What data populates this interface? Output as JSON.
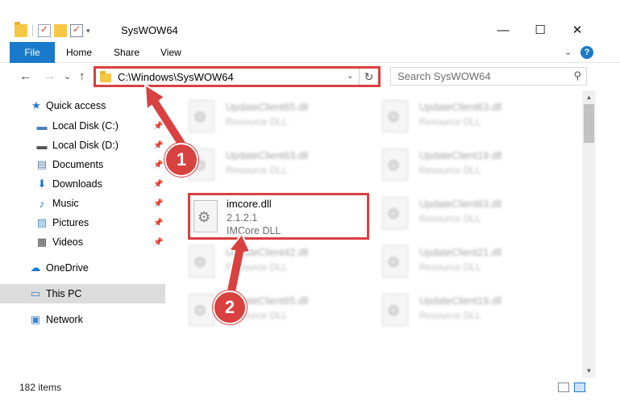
{
  "window": {
    "title": "SysWOW64",
    "controls": {
      "minimize": "—",
      "maximize": "☐",
      "close": "✕"
    }
  },
  "ribbon": {
    "tabs": {
      "file": "File",
      "home": "Home",
      "share": "Share",
      "view": "View"
    },
    "help": "?"
  },
  "addressbar": {
    "path": "C:\\Windows\\SysWOW64",
    "back": "←",
    "forward": "→",
    "recent": "⌄",
    "up": "↑",
    "refresh": "↻"
  },
  "search": {
    "placeholder": "Search SysWOW64"
  },
  "nav": {
    "quick_access": "Quick access",
    "local_c": "Local Disk (C:)",
    "local_d": "Local Disk (D:)",
    "documents": "Documents",
    "downloads": "Downloads",
    "music": "Music",
    "pictures": "Pictures",
    "videos": "Videos",
    "onedrive": "OneDrive",
    "this_pc": "This PC",
    "network": "Network"
  },
  "files": {
    "blurred": [
      {
        "name": "UpdateClient65.dll",
        "desc": "Resource DLL"
      },
      {
        "name": "UpdateClient63.dll",
        "desc": "Resource DLL"
      },
      {
        "name": "UpdateClient63.dll",
        "desc": "Resource DLL"
      },
      {
        "name": "UpdateClient19.dll",
        "desc": "Resource DLL"
      },
      {
        "name": "UpdateClient63.dll",
        "desc": "Resource DLL"
      },
      {
        "name": "UpdateClient42.dll",
        "desc": "Resource DLL"
      },
      {
        "name": "UpdateClient21.dll",
        "desc": "Resource DLL"
      },
      {
        "name": "UpdateClient65.dll",
        "desc": "Resource DLL"
      },
      {
        "name": "UpdateClient19.dll",
        "desc": "Resource DLL"
      }
    ],
    "highlighted": {
      "name": "imcore.dll",
      "version": "2.1.2.1",
      "desc": "IMCore DLL"
    }
  },
  "status": {
    "count": "182 items"
  },
  "callouts": {
    "step1": "1",
    "step2": "2"
  },
  "colors": {
    "accent": "#1979ca",
    "callout": "#d94040"
  }
}
